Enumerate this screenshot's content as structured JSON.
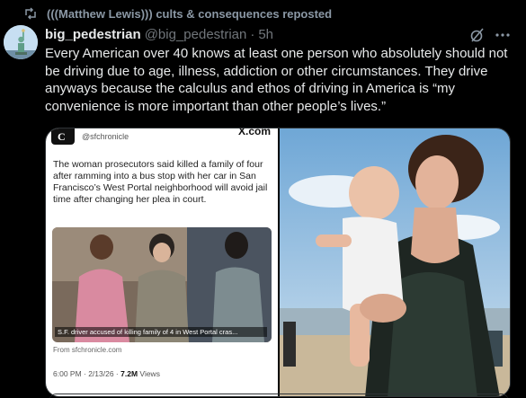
{
  "repost": {
    "label": "(((Matthew Lewis))) cults & consequences reposted",
    "icon": "repost-icon"
  },
  "post": {
    "display_name": "big_pedestrian",
    "handle": "@big_pedestrian",
    "separator": "·",
    "time": "5h",
    "avatar_icon": "statue-of-liberty-avatar",
    "grok_icon": "grok-icon",
    "more_icon": "more-icon",
    "text": "Every American over 40 knows at least one person who absolutely should not be driving due to age, illness, addiction or other circumstances. They drive anyways because the calculus and ethos of driving in America is “my convenience is more important than other people’s lives.”"
  },
  "media": {
    "left": {
      "handle": "@sfchronicle",
      "site": "X.com",
      "headline": "The woman prosecutors said killed a family of four after ramming into a bus stop with her car in San Francisco’s West Portal neighborhood will avoid jail time after changing her plea in court.",
      "photo_caption": "S.F. driver accused of killing family of 4 in West Portal cras...",
      "from": "From sfchronicle.com",
      "time": "6:00 PM · 2/13/26 ·",
      "views_count": "7.2M",
      "views_label": "Views"
    },
    "right": {
      "description_icon": "photo-woman-holding-baby"
    }
  },
  "colors": {
    "background": "#000000",
    "text_primary": "#e7e9ea",
    "text_secondary": "#71767b",
    "border": "#2f3336"
  }
}
